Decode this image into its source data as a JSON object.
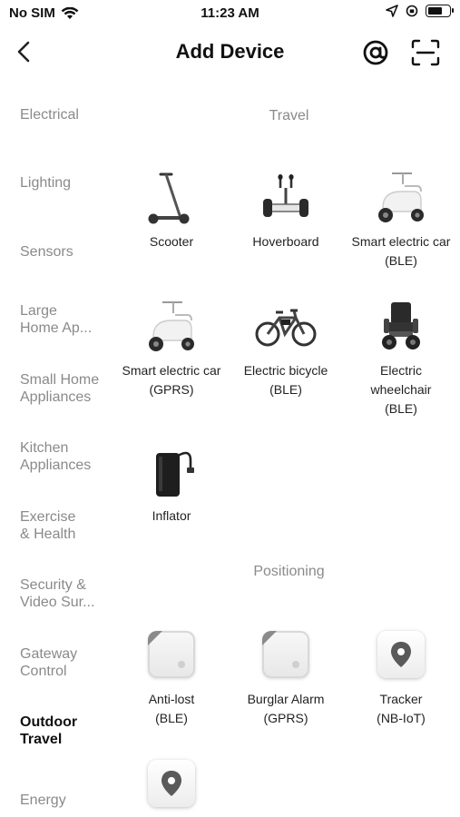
{
  "status_bar": {
    "carrier": "No SIM",
    "time": "11:23 AM",
    "battery_level": 0.7
  },
  "nav": {
    "title": "Add Device",
    "back_icon": "chevron-left-icon",
    "at_icon": "at-sign-icon",
    "scan_icon": "scan-icon"
  },
  "sidebar": {
    "items": [
      {
        "label": "Electrical",
        "active": false
      },
      {
        "label": "Lighting",
        "active": false
      },
      {
        "label": "Sensors",
        "active": false
      },
      {
        "label": "Large\nHome Ap...",
        "active": false
      },
      {
        "label": "Small Home\nAppliances",
        "active": false
      },
      {
        "label": "Kitchen\nAppliances",
        "active": false
      },
      {
        "label": "Exercise\n& Health",
        "active": false
      },
      {
        "label": "Security &\nVideo Sur...",
        "active": false
      },
      {
        "label": "Gateway\nControl",
        "active": false
      },
      {
        "label": "Outdoor\nTravel",
        "active": true
      },
      {
        "label": "Energy",
        "active": false
      }
    ]
  },
  "sections": [
    {
      "title": "Travel",
      "devices": [
        {
          "label": "Scooter",
          "icon": "scooter-icon"
        },
        {
          "label": "Hoverboard",
          "icon": "hoverboard-icon"
        },
        {
          "label": "Smart electric car\n(BLE)",
          "icon": "electric-moped-icon"
        },
        {
          "label": "Smart electric car\n(GPRS)",
          "icon": "electric-moped-icon"
        },
        {
          "label": "Electric bicycle\n(BLE)",
          "icon": "bicycle-icon"
        },
        {
          "label": "Electric\nwheelchair\n(BLE)",
          "icon": "wheelchair-icon"
        },
        {
          "label": "Inflator",
          "icon": "inflator-icon"
        }
      ]
    },
    {
      "title": "Positioning",
      "devices": [
        {
          "label": "Anti-lost\n(BLE)",
          "icon": "tag-icon"
        },
        {
          "label": "Burglar Alarm\n(GPRS)",
          "icon": "tag-icon"
        },
        {
          "label": "Tracker\n(NB-IoT)",
          "icon": "location-pin-icon"
        },
        {
          "label": "",
          "icon": "location-pin-icon"
        }
      ]
    }
  ]
}
